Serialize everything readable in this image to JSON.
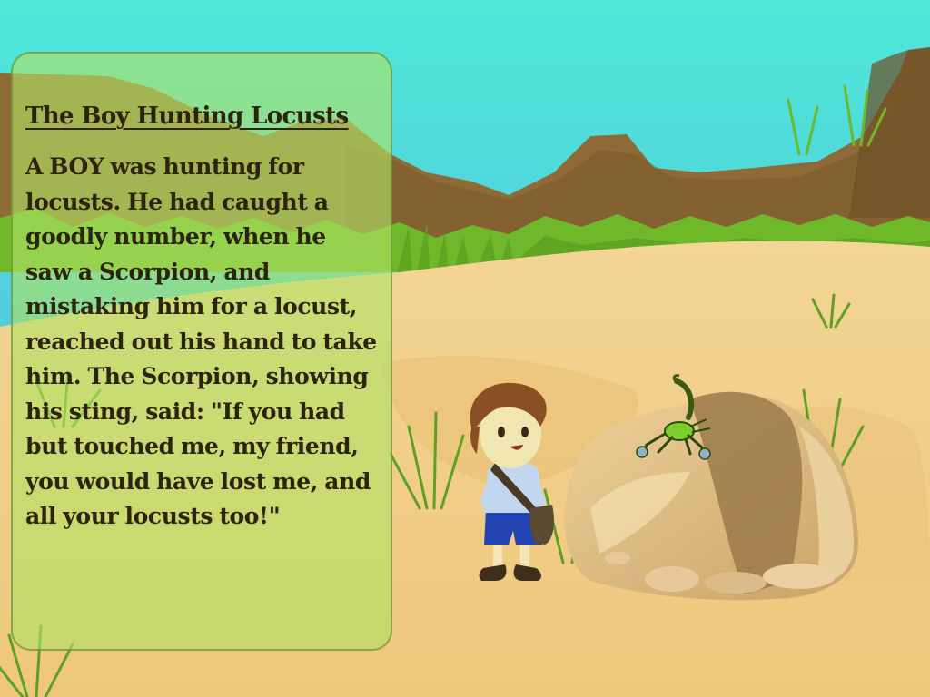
{
  "story": {
    "title": "The Boy Hunting Locusts",
    "body": "A BOY was hunting for locusts. He had caught a goodly number, when he saw a Scorpion, and mistaking him for a locust, reached out his hand to take him. The Scorpion, showing his sting, said: \"If you had but touched me, my friend, you would have lost me, and all your locusts too!\""
  },
  "scene": {
    "characters": [
      "boy",
      "scorpion"
    ],
    "props": [
      "boulder",
      "satchel",
      "grass-tufts",
      "pebbles"
    ],
    "setting": "desert-hills"
  },
  "colors": {
    "sky_top": "#4ee8d8",
    "sky_bottom": "#57aee6",
    "hills": "#8e6a36",
    "sand": "#f0cf8c",
    "grass": "#6fb82a",
    "panel": "#b0e264",
    "text": "#2d2410"
  }
}
